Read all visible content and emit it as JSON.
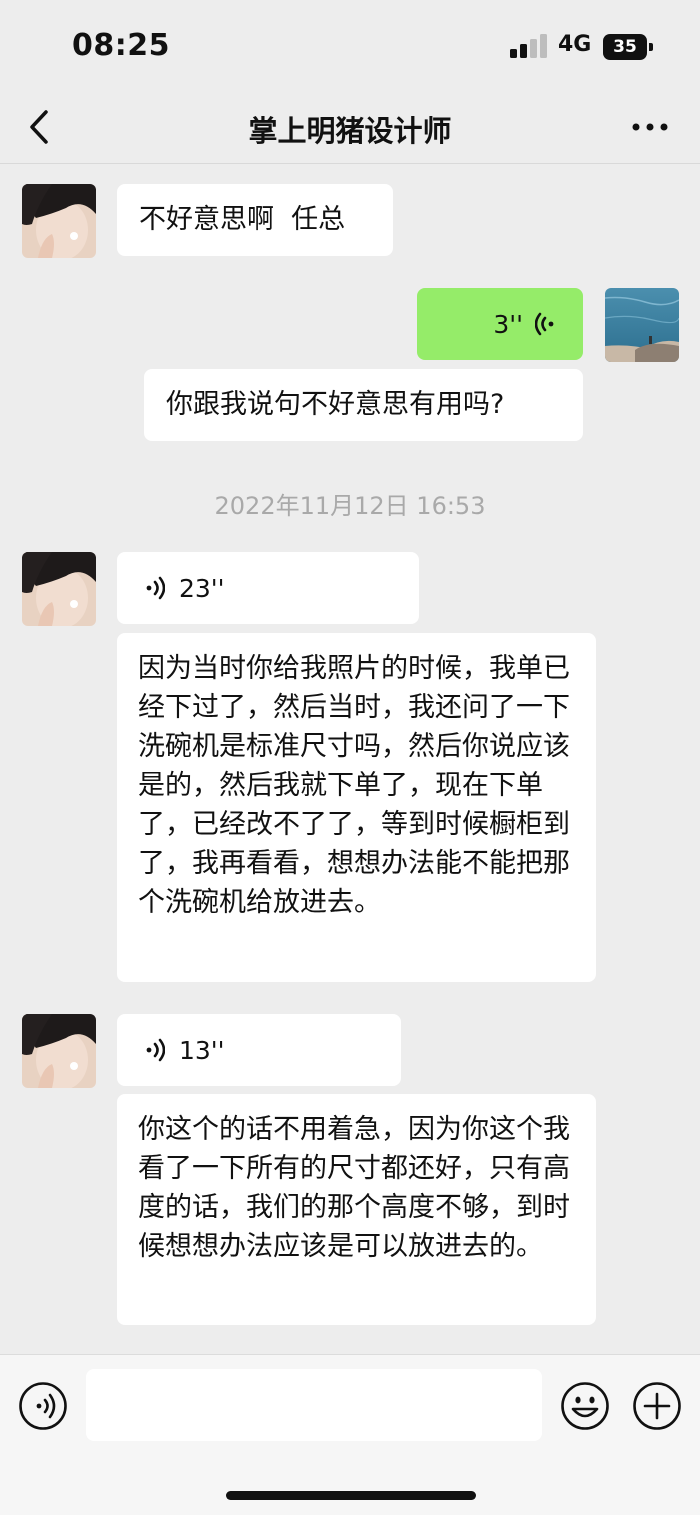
{
  "status_bar": {
    "time": "08:25",
    "network": "4G",
    "battery": "35"
  },
  "header": {
    "title": "掌上明猪设计师"
  },
  "messages": {
    "m1": {
      "text": "不好意思啊  任总"
    },
    "m2": {
      "duration": "3''"
    },
    "m3": {
      "text": "你跟我说句不好意思有用吗?"
    },
    "timestamp": "2022年11月12日 16:53",
    "m4": {
      "duration": "23''"
    },
    "m5": {
      "text": "因为当时你给我照片的时候，我单已经下过了，然后当时，我还问了一下洗碗机是标准尺寸吗，然后你说应该是的，然后我就下单了，现在下单了，已经改不了了，等到时候橱柜到了，我再看看，想想办法能不能把那个洗碗机给放进去。"
    },
    "m6": {
      "duration": "13''"
    },
    "m7": {
      "text": "你这个的话不用着急，因为你这个我看了一下所有的尺寸都还好，只有高度的话，我们的那个高度不够，到时候想想办法应该是可以放进去的。"
    }
  },
  "input_bar": {
    "placeholder": ""
  },
  "colors": {
    "me_bubble": "#95ec69",
    "other_bubble": "#ffffff",
    "background": "#ededed"
  },
  "icons": {
    "back": "chevron-left-icon",
    "more": "more-dots-icon",
    "voice_input": "voice-input-icon",
    "emoji": "emoji-icon",
    "add": "plus-icon"
  }
}
